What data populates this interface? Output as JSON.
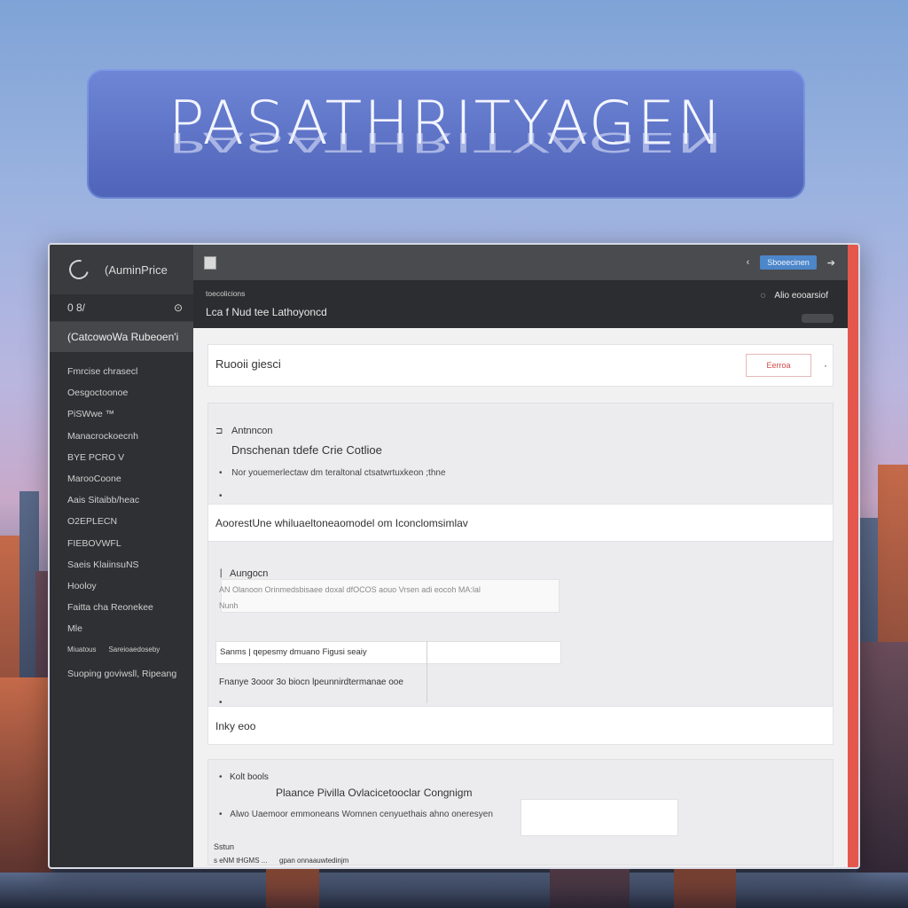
{
  "banner": {
    "title": "PASATHRITYAGEN"
  },
  "sidebar": {
    "brand": "(AuminPrice",
    "row_left": "0 8/",
    "row_right": "⊙",
    "active": "(CatcowoWa Rubeoen'i",
    "items": [
      "Fmrcise chrasecl",
      "Oesgoctoonoe",
      "PiSWwe ™",
      "Manacrockoecnh",
      "BYE PCRO V",
      "MarooCoone",
      "Aais Sitaibb/heac",
      "O2EPLECN",
      "FIEBOVWFL",
      "Saeis KlaiinsuNS",
      "Hooloy",
      "Faitta cha Reonekee",
      "Mle"
    ],
    "small_left": "Miuatous",
    "small_right": "Sareioaedoseby",
    "bottom": "Suoping goviwsll, Ripeang"
  },
  "topbar": {
    "right_marker": "‹",
    "pill": "Sboeecinen",
    "arrow": "➔"
  },
  "subbar": {
    "small": "toecolicions",
    "big": "Lca   f  Nud tee Lathoyoncd",
    "right": "Alio eooarsiof"
  },
  "card1": {
    "title": "Ruooii giesci",
    "button": "Eerroa",
    "dot": "·"
  },
  "panel1": {
    "heading": "Antnncon",
    "sub": "Dnschenan tdefe Crie Cotlioe",
    "bullet1": "Nor youemerlectaw dm teraltonal ctsatwrtuxkeon ;thne",
    "bullet2": ""
  },
  "card2": {
    "text": "AoorestUne whiluaeltoneaomodel om Iconclomsimlav"
  },
  "panel2": {
    "heading": "Aungocn",
    "bullet1": "AN Olanoon Orinmedsbisaee doxal   dfOCOS  aouo Vrsen adi eocoh MA:lal",
    "bullet2": "Nunh",
    "field_text": "Sanms | qepesmy dmuano Figusi seaiy",
    "line": "Fnanye 3ooor 3o biocn lpeunnirdtermanae ooe",
    "bullet3": ""
  },
  "card3": {
    "text": "Inky eoo"
  },
  "panel3": {
    "heading": "Kolt bools",
    "sub": "Plaance  Pivilla  Ovlacicetooclar Congnigm",
    "bullet1": "Alwo Uaemoor emmoneans Womnen cenyuethais ahno oneresyen",
    "label": "Sstun",
    "bottom_a": "s eNM tHGMS ...",
    "bottom_b": "gpan onnaauwtedinjm"
  }
}
